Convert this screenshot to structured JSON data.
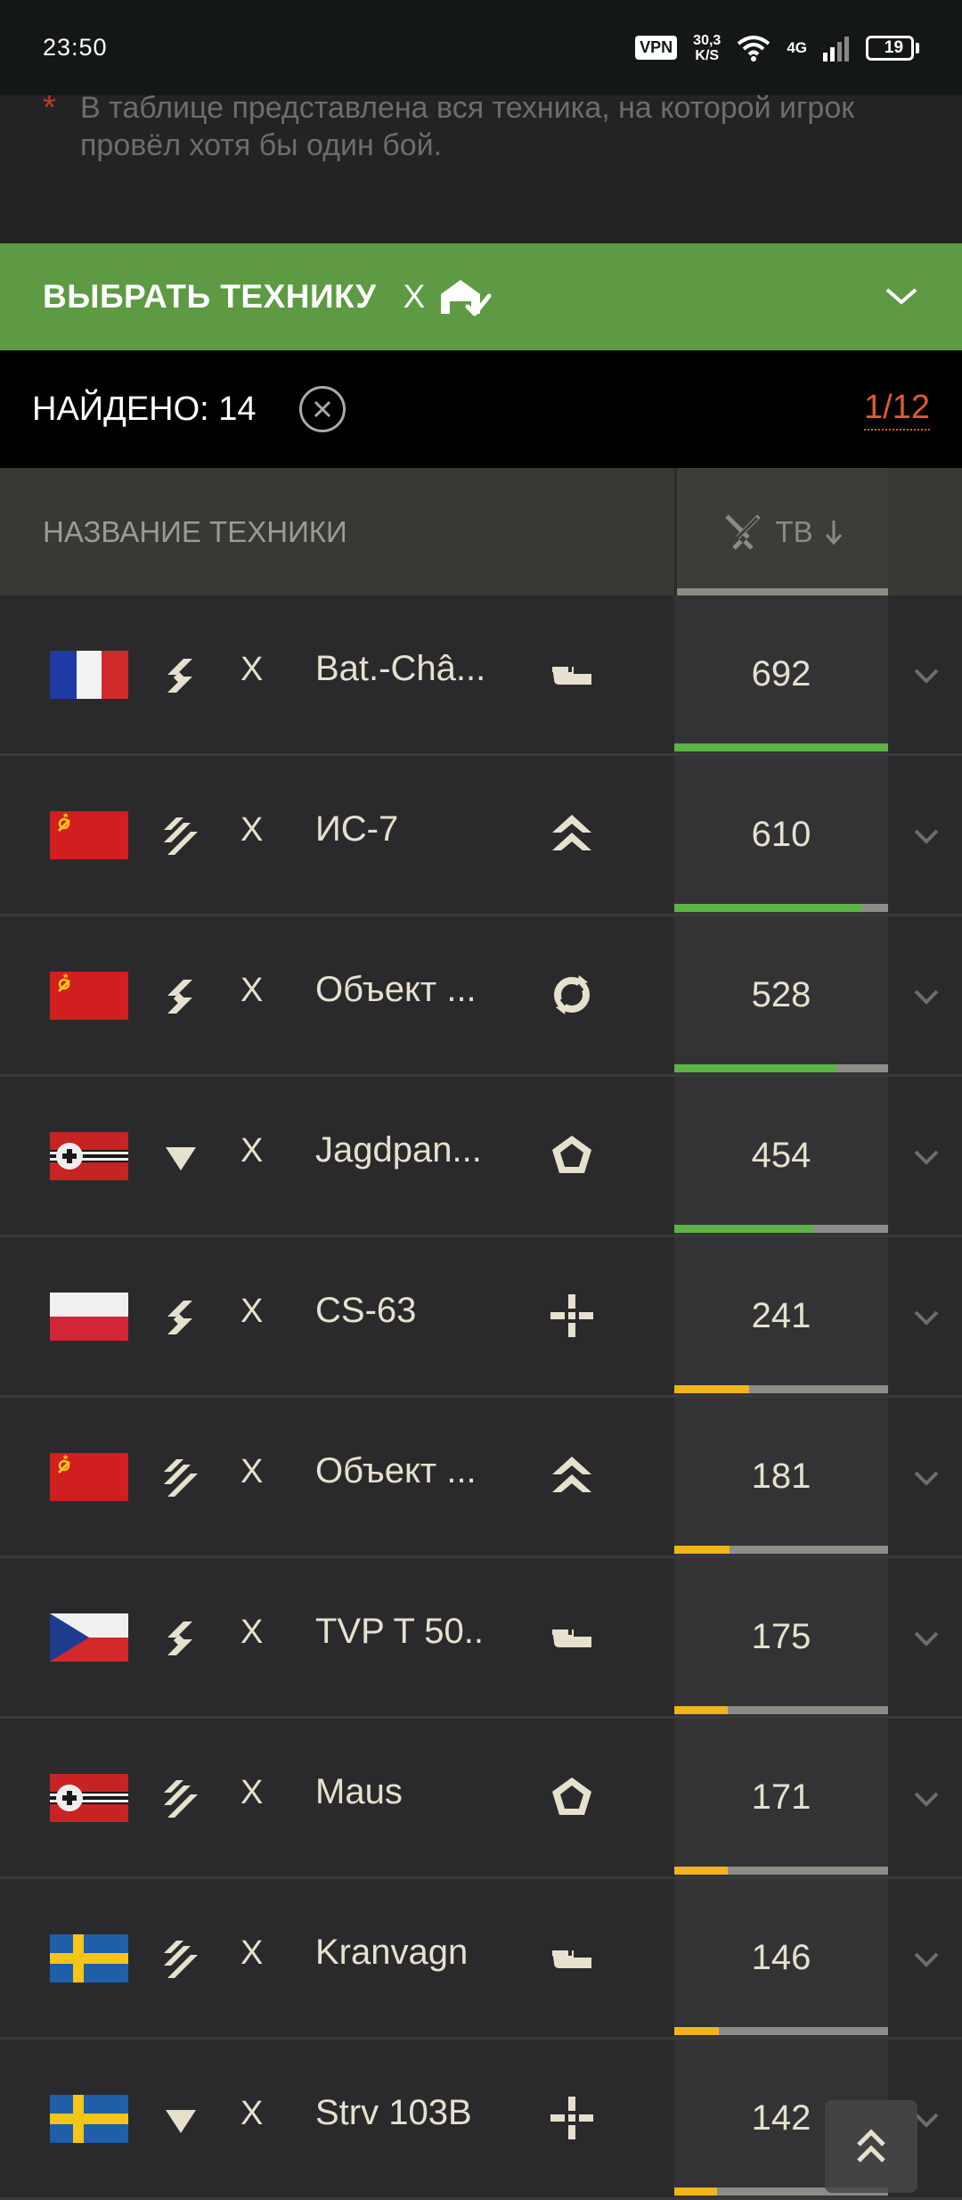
{
  "status_bar": {
    "time": "23:50",
    "vpn": "VPN",
    "speed_value": "30,3",
    "speed_unit": "K/S",
    "network": "4G",
    "battery": "19"
  },
  "note": {
    "marker": "*",
    "text": "В таблице представлена вся техника, на которой игрок провёл хотя бы один бой."
  },
  "filter": {
    "select_label": "ВЫБРАТЬ ТЕХНИКУ",
    "select_tier": "X",
    "icon": "garage-check-icon"
  },
  "results": {
    "found_label": "НАЙДЕНО: 14",
    "page": "1/12"
  },
  "table": {
    "column_name": "НАЗВАНИЕ ТЕХНИКИ",
    "column_sort": "ТВ",
    "sort_direction": "desc",
    "rows": [
      {
        "nation": "france",
        "rank": "double-chevron",
        "tier": "X",
        "name": "Bat.-Châ...",
        "class": "light-tank",
        "value": "692",
        "bar_pct": 100,
        "bar_color": "#5bb445"
      },
      {
        "nation": "ussr",
        "rank": "triple-chevron",
        "tier": "X",
        "name": "ИС-7",
        "class": "heavy-tank",
        "value": "610",
        "bar_pct": 88,
        "bar_color": "#5bb445"
      },
      {
        "nation": "ussr",
        "rank": "double-chevron",
        "tier": "X",
        "name": "Объект ...",
        "class": "medium-tank",
        "value": "528",
        "bar_pct": 76,
        "bar_color": "#5bb445"
      },
      {
        "nation": "germany",
        "rank": "triangle",
        "tier": "X",
        "name": "Jagdpan...",
        "class": "td",
        "value": "454",
        "bar_pct": 65,
        "bar_color": "#5bb445"
      },
      {
        "nation": "poland",
        "rank": "double-chevron",
        "tier": "X",
        "name": "CS-63",
        "class": "spg",
        "value": "241",
        "bar_pct": 35,
        "bar_color": "#f2b31c"
      },
      {
        "nation": "ussr",
        "rank": "triple-chevron",
        "tier": "X",
        "name": "Объект ...",
        "class": "heavy-tank",
        "value": "181",
        "bar_pct": 26,
        "bar_color": "#f2b31c"
      },
      {
        "nation": "czech",
        "rank": "double-chevron",
        "tier": "X",
        "name": "TVP T 50...",
        "class": "light-tank",
        "value": "175",
        "bar_pct": 25,
        "bar_color": "#f2b31c"
      },
      {
        "nation": "germany",
        "rank": "triple-chevron",
        "tier": "X",
        "name": "Maus",
        "class": "td",
        "value": "171",
        "bar_pct": 25,
        "bar_color": "#f2b31c"
      },
      {
        "nation": "sweden",
        "rank": "triple-chevron",
        "tier": "X",
        "name": "Kranvagn",
        "class": "light-tank",
        "value": "146",
        "bar_pct": 21,
        "bar_color": "#f2b31c"
      },
      {
        "nation": "sweden",
        "rank": "triangle",
        "tier": "X",
        "name": "Strv 103B",
        "class": "spg",
        "value": "142",
        "bar_pct": 20,
        "bar_color": "#f2b31c"
      }
    ]
  }
}
